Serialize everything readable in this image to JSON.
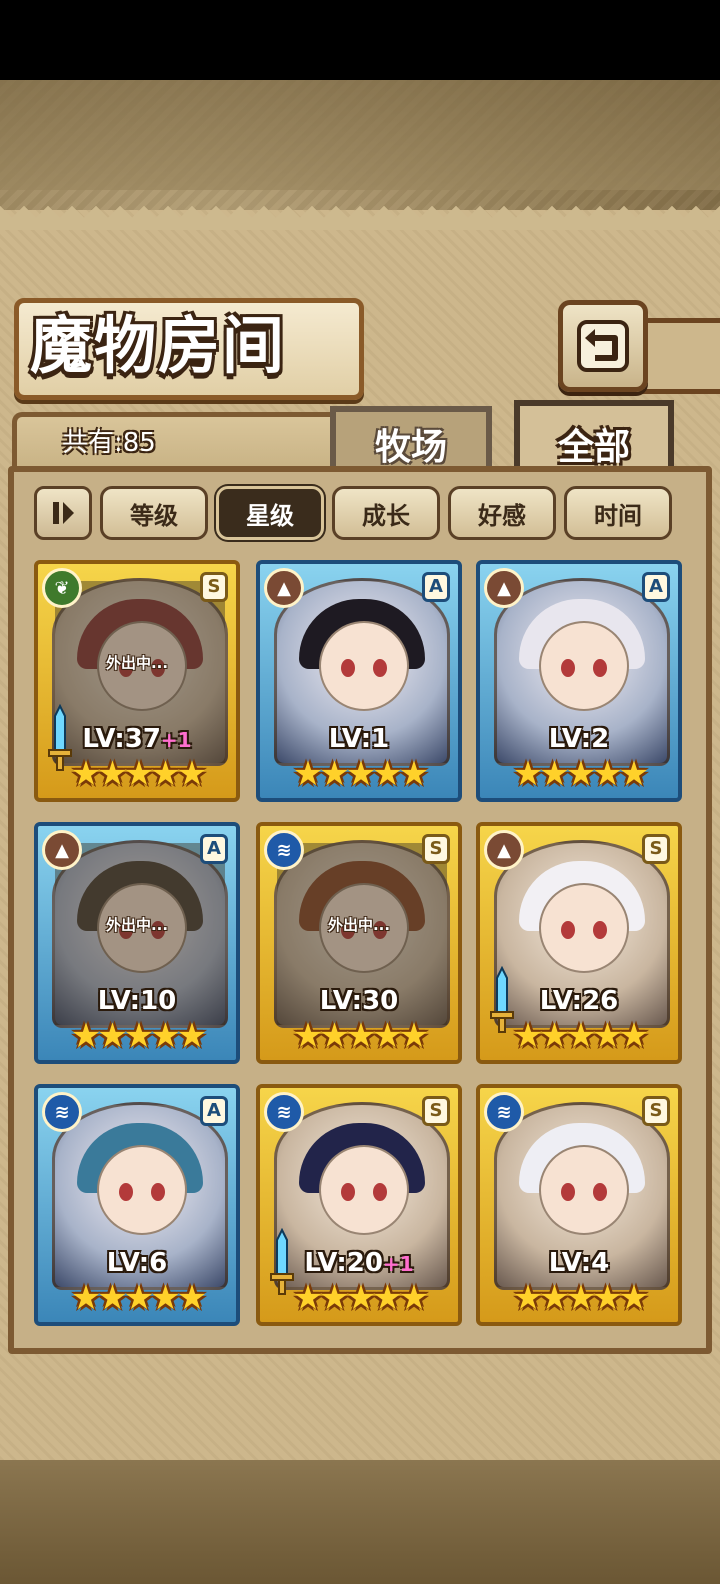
{
  "header": {
    "title": "魔物房间",
    "back_icon": "return-arrow-icon"
  },
  "tabs": {
    "count_label": "共有:85",
    "pasture": "牧场",
    "all": "全部"
  },
  "filters": [
    {
      "label": "等级",
      "active": false
    },
    {
      "label": "星级",
      "active": true
    },
    {
      "label": "成长",
      "active": false
    },
    {
      "label": "好感",
      "active": false
    },
    {
      "label": "时间",
      "active": false
    }
  ],
  "monsters": [
    {
      "level": "LV:37",
      "bonus": "+1",
      "rank": "S",
      "element": "grass",
      "frame": "gold",
      "away": "外出中...",
      "equipped": true,
      "stars": "★★★★★",
      "hair": "#8a3a3a"
    },
    {
      "level": "LV:1",
      "bonus": "",
      "rank": "A",
      "element": "earth",
      "frame": "blue",
      "away": "",
      "equipped": false,
      "stars": "★★★★★",
      "hair": "#1e1a22"
    },
    {
      "level": "LV:2",
      "bonus": "",
      "rank": "A",
      "element": "earth",
      "frame": "blue",
      "away": "",
      "equipped": false,
      "stars": "★★★★★",
      "hair": "#e8e6ee"
    },
    {
      "level": "LV:10",
      "bonus": "",
      "rank": "A",
      "element": "earth",
      "frame": "blue",
      "away": "外出中...",
      "equipped": false,
      "stars": "★★★★★",
      "hair": "#4a4038"
    },
    {
      "level": "LV:30",
      "bonus": "",
      "rank": "S",
      "element": "water",
      "frame": "gold",
      "away": "外出中...",
      "equipped": false,
      "stars": "★★★★★",
      "hair": "#8a4a2a"
    },
    {
      "level": "LV:26",
      "bonus": "",
      "rank": "S",
      "element": "earth",
      "frame": "gold",
      "away": "",
      "equipped": true,
      "stars": "★★★★★",
      "hair": "#f2f0f4"
    },
    {
      "level": "LV:6",
      "bonus": "",
      "rank": "A",
      "element": "water",
      "frame": "blue",
      "away": "",
      "equipped": false,
      "stars": "★★★★★",
      "hair": "#3a7a9a"
    },
    {
      "level": "LV:20",
      "bonus": "+1",
      "rank": "S",
      "element": "water",
      "frame": "gold",
      "away": "",
      "equipped": true,
      "stars": "★★★★★",
      "hair": "#22244a"
    },
    {
      "level": "LV:4",
      "bonus": "",
      "rank": "S",
      "element": "water",
      "frame": "gold",
      "away": "",
      "equipped": false,
      "stars": "★★★★★",
      "hair": "#eeeef4"
    }
  ]
}
